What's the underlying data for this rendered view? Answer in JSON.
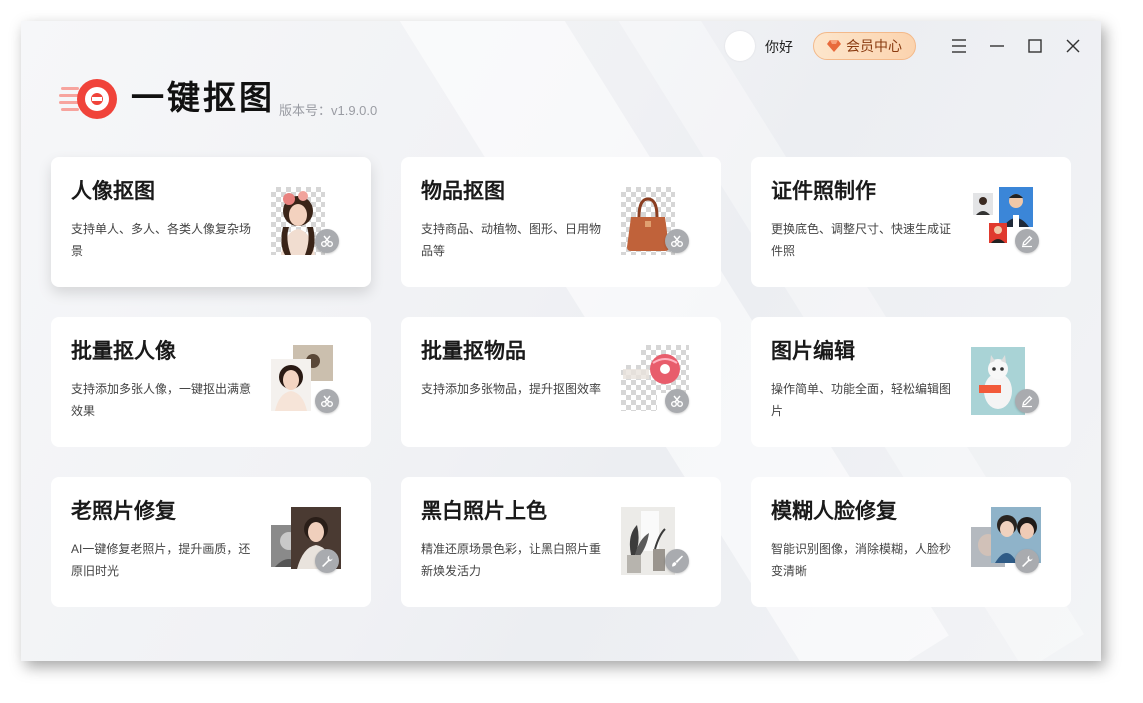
{
  "header": {
    "greeting": "你好",
    "vip_label": "会员中心"
  },
  "app": {
    "name": "一键抠图",
    "version": "版本号：v1.9.0.0"
  },
  "cards": [
    {
      "title": "人像抠图",
      "desc": "支持单人、多人、各类人像复杂场景",
      "badge": "scissors-icon"
    },
    {
      "title": "物品抠图",
      "desc": "支持商品、动植物、图形、日用物品等",
      "badge": "scissors-icon"
    },
    {
      "title": "证件照制作",
      "desc": "更换底色、调整尺寸、快速生成证件照",
      "badge": "pencil-icon"
    },
    {
      "title": "批量抠人像",
      "desc": "支持添加多张人像，一键抠出满意效果",
      "badge": "scissors-icon"
    },
    {
      "title": "批量抠物品",
      "desc": "支持添加多张物品，提升抠图效率",
      "badge": "scissors-icon"
    },
    {
      "title": "图片编辑",
      "desc": "操作简单、功能全面，轻松编辑图片",
      "badge": "pencil-icon"
    },
    {
      "title": "老照片修复",
      "desc": "AI一键修复老照片，提升画质，还原旧时光",
      "badge": "wrench-icon"
    },
    {
      "title": "黑白照片上色",
      "desc": "精准还原场景色彩，让黑白照片重新焕发活力",
      "badge": "brush-icon"
    },
    {
      "title": "模糊人脸修复",
      "desc": "智能识别图像，消除模糊，人脸秒变清晰",
      "badge": "wrench-icon"
    }
  ],
  "colors": {
    "accent": "#f0433a",
    "vip_text": "#8a3b10",
    "badge": "#a9abaf"
  }
}
